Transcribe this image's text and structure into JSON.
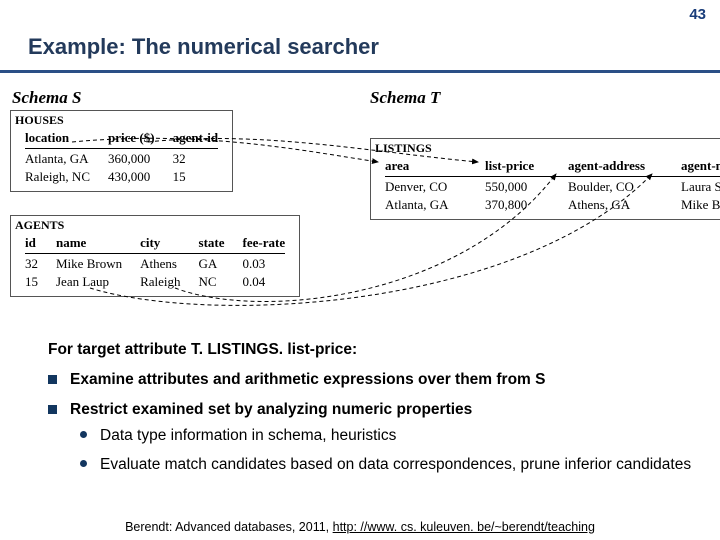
{
  "pagenum": "43",
  "title": "Example: The numerical searcher",
  "schemaS": {
    "label": "Schema S",
    "houses": {
      "name": "HOUSES",
      "headers": [
        "location",
        "price ($)",
        "agent-id"
      ],
      "rows": [
        [
          "Atlanta, GA",
          "360,000",
          "32"
        ],
        [
          "Raleigh, NC",
          "430,000",
          "15"
        ]
      ]
    },
    "agents": {
      "name": "AGENTS",
      "headers": [
        "id",
        "name",
        "city",
        "state",
        "fee-rate"
      ],
      "rows": [
        [
          "32",
          "Mike Brown",
          "Athens",
          "GA",
          "0.03"
        ],
        [
          "15",
          "Jean Laup",
          "Raleigh",
          "NC",
          "0.04"
        ]
      ]
    }
  },
  "schemaT": {
    "label": "Schema T",
    "listings": {
      "name": "LISTINGS",
      "headers": [
        "area",
        "list-price",
        "agent-address",
        "agent-name"
      ],
      "rows": [
        [
          "Denver, CO",
          "550,000",
          "Boulder, CO",
          "Laura Smith"
        ],
        [
          "Atlanta, GA",
          "370,800",
          "Athens, GA",
          "Mike Brown"
        ]
      ]
    }
  },
  "body": {
    "lead": "For target attribute T. LISTINGS. list-price:",
    "b1": "Examine attributes and arithmetic expressions over them from S",
    "b2": "Restrict examined set by analyzing numeric properties",
    "b2a": "Data type information in schema, heuristics",
    "b2b": "Evaluate match candidates based on data correspondences, prune inferior candidates"
  },
  "footer": {
    "pre": "Berendt: Advanced databases, 2011, ",
    "link": "http: //www. cs. kuleuven. be/~berendt/teaching"
  }
}
